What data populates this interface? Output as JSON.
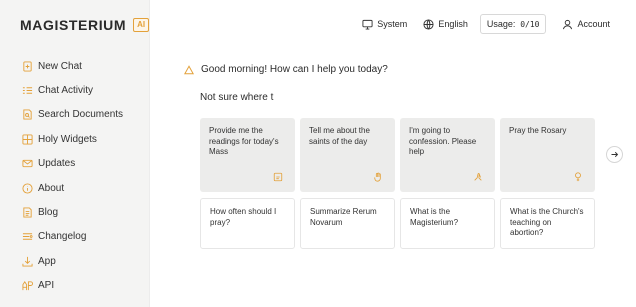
{
  "brand": {
    "name": "MAGISTERIUM",
    "badge": "AI"
  },
  "sidebar": {
    "items": [
      {
        "label": "New Chat",
        "icon": "new-chat-icon"
      },
      {
        "label": "Chat Activity",
        "icon": "list-icon"
      },
      {
        "label": "Search Documents",
        "icon": "search-document-icon"
      },
      {
        "label": "Holy Widgets",
        "icon": "widgets-icon"
      },
      {
        "label": "Updates",
        "icon": "mail-icon"
      },
      {
        "label": "About",
        "icon": "info-icon"
      },
      {
        "label": "Blog",
        "icon": "document-icon"
      },
      {
        "label": "Changelog",
        "icon": "changelog-icon"
      },
      {
        "label": "App",
        "icon": "download-icon"
      },
      {
        "label": "API",
        "icon": "api-icon"
      }
    ],
    "icon_color": "#e3a13a"
  },
  "topbar": {
    "system": "System",
    "language": "English",
    "usage_label": "Usage:",
    "usage_value": "0/10",
    "account": "Account"
  },
  "chat": {
    "greeting": "Good morning! How can I help you today?",
    "input_value": "Not sure where t"
  },
  "suggestions": [
    {
      "text": "Provide me the readings for today's Mass",
      "icon": "calendar-icon"
    },
    {
      "text": "Tell me about the saints of the day",
      "icon": "hand-icon"
    },
    {
      "text": "I'm going to confession. Please help",
      "icon": "pray-hands-icon"
    },
    {
      "text": "Pray the Rosary",
      "icon": "rosary-icon"
    },
    {
      "text": "How often should I pray?"
    },
    {
      "text": "Summarize Rerum Novarum"
    },
    {
      "text": "What is the Magisterium?"
    },
    {
      "text": "What is the Church's teaching on abortion?"
    }
  ]
}
